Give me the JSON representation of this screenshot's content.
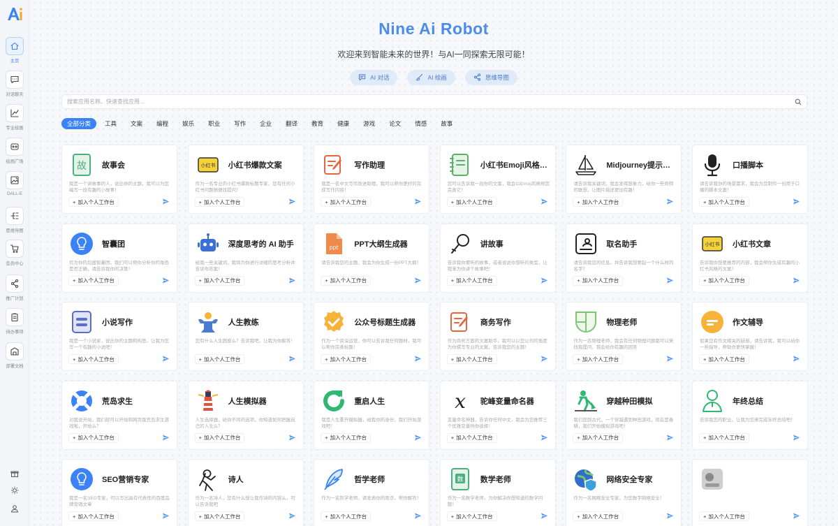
{
  "app": {
    "title": "Nine Ai Robot",
    "subtitle": "欢迎来到智能未来的世界！与AI一同探索无限可能！"
  },
  "sidebar": {
    "logo": {
      "text": "Ai",
      "colors": [
        "#3b82f6",
        "#f5a623"
      ]
    },
    "items": [
      {
        "label": "主页",
        "icon": "home-icon",
        "active": true
      },
      {
        "label": "对话聊天",
        "icon": "chat-icon"
      },
      {
        "label": "专业绘画",
        "icon": "chart-icon"
      },
      {
        "label": "绘画广场",
        "icon": "gallery-icon"
      },
      {
        "label": "DALL-E",
        "icon": "image-edit-icon"
      },
      {
        "label": "思维导图",
        "icon": "mindmap-icon"
      },
      {
        "label": "会员中心",
        "icon": "cart-icon"
      },
      {
        "label": "推广计划",
        "icon": "share-icon"
      },
      {
        "label": "待办事项",
        "icon": "clipboard-icon"
      },
      {
        "label": "部署文档",
        "icon": "building-icon"
      }
    ],
    "bottom": [
      {
        "icon": "gift-icon"
      },
      {
        "icon": "sun-icon"
      },
      {
        "icon": "user-icon"
      }
    ]
  },
  "quick_actions": [
    {
      "label": "AI 对话",
      "icon": "chat-icon"
    },
    {
      "label": "AI 绘画",
      "icon": "brush-icon"
    },
    {
      "label": "思维导图",
      "icon": "mindmap-icon"
    }
  ],
  "search": {
    "placeholder": "搜索应用名称、快速查找应用..."
  },
  "categories": [
    {
      "label": "全部分类",
      "active": true
    },
    {
      "label": "工具"
    },
    {
      "label": "文案"
    },
    {
      "label": "编程"
    },
    {
      "label": "娱乐"
    },
    {
      "label": "职业"
    },
    {
      "label": "写作"
    },
    {
      "label": "企业"
    },
    {
      "label": "翻译"
    },
    {
      "label": "教育"
    },
    {
      "label": "健康"
    },
    {
      "label": "游戏"
    },
    {
      "label": "论文"
    },
    {
      "label": "情感"
    },
    {
      "label": "故事"
    }
  ],
  "add_label": "加入个人工作台",
  "accent": "#3b82f6",
  "cards": [
    {
      "name": "故事会",
      "desc": "我是一个讲故事的人，说出你的主题，我可以为您编写一段有趣的小故事！",
      "icon": "book-icon",
      "color": "#4caf7d"
    },
    {
      "name": "小红书爆款文案",
      "desc": "作为一名专业的小红书爆款标题专家，您有任何小红书问题随便找提问！",
      "icon": "xiaohongshu-icon",
      "color": "#f5d23a"
    },
    {
      "name": "写作助理",
      "desc": "我是一名中文写作改进助理，我可以帮你更好的完成写作内容！",
      "icon": "edit-icon",
      "color": "#e8643c"
    },
    {
      "name": "小红书Emoji风格…",
      "desc": "您可以告诉我一段你的文案，我会以Emoji风格帮您完善它！",
      "icon": "notebook-icon",
      "color": "#5fae6a"
    },
    {
      "name": "Midjourney提示…",
      "desc": "请告诉我关键词，我会发挥想象力，给你一些奇特的联想，让图片描述更加有趣！",
      "icon": "sailboat-icon",
      "color": "#222222"
    },
    {
      "name": "口播脚本",
      "desc": "请告诉我你的场景需求，我会为您制作一份用于口播的脚本文案！",
      "icon": "microphone-icon",
      "color": "#222222"
    },
    {
      "name": "智囊团",
      "desc": "作为你的后援智囊团，我们可以帮你分析你的角色是否正确，请告诉我你的决策！",
      "icon": "bulb-icon",
      "color": "#3b82f6"
    },
    {
      "name": "深度思考的 AI 助手",
      "desc": "给我一些关键词，我将为你进行详细的思考分析并告诉你答案！",
      "icon": "robot-icon",
      "color": "#3b6fd6"
    },
    {
      "name": "PPT大纲生成器",
      "desc": "请告诉我您的主题，我会为你生成一份PPT大纲！",
      "icon": "ppt-icon",
      "color": "#f08a4b"
    },
    {
      "name": "讲故事",
      "desc": "告诉我你要听的故事，或者说说你想听的类型，让我来为你讲个故事吧！",
      "icon": "mic-icon",
      "color": "#222222"
    },
    {
      "name": "取名助手",
      "desc": "请告诉我您的信息，并告诉我想要起一个什么样的名字？",
      "icon": "name-card-icon",
      "color": "#222222"
    },
    {
      "name": "小红书文章",
      "desc": "告诉我你想要推荐的内容，我会帮你生成有趣的小红书风格的文案！",
      "icon": "xiaohongshu-icon",
      "color": "#f5d23a"
    },
    {
      "name": "小说写作",
      "desc": "我是一个小说家，说出你的主题和构思，让我为您写一个有趣的小说吧！",
      "icon": "notes-icon",
      "color": "#5b6cc9"
    },
    {
      "name": "人生教练",
      "desc": "您有什么人生困惑么？告诉我吧，让我为你解答！",
      "icon": "strongman-icon",
      "color": "#4a7bd0"
    },
    {
      "name": "公众号标题生成器",
      "desc": "作为一个资深运营，你可以告诉我任何题材，我可以帮你完善标题！",
      "icon": "badge-check-icon",
      "color": "#f5b33a"
    },
    {
      "name": "商务写作",
      "desc": "作为商务方面的文案助手，我可以以您公司的角度为你撰写专业的文案，告诉我您的主题！",
      "icon": "edit-icon",
      "color": "#e8643c"
    },
    {
      "name": "物理老师",
      "desc": "作为一名物理老师，我会有任何物理问题都可以来找我提问，我会给你有趣的回答",
      "icon": "physics-icon",
      "color": "#7cc576"
    },
    {
      "name": "作文辅导",
      "desc": "如果您有作文相关的疑惑，请告诉我，我可以给你一些指导，帮助你更快掌握！",
      "icon": "essay-icon",
      "color": "#f5b33a"
    },
    {
      "name": "荒岛求生",
      "desc": "对我说开始，我们就可以开始和网页版荒岛求生游戏啦，开始么？",
      "icon": "lifebuoy-icon",
      "color": "#3b82f6"
    },
    {
      "name": "人生模拟器",
      "desc": "人生选择器，给你不同的选项，你知道如何把握自己的人生么？",
      "icon": "lighthouse-icon",
      "color": "#e0533d"
    },
    {
      "name": "重启人生",
      "desc": "我是人生重开模拟器，给我你的身份，我们开始游戏吧！",
      "icon": "restart-icon",
      "color": "#2eb872"
    },
    {
      "name": "驼峰变量命名器",
      "desc": "变量命名神器，告诉你任何中文，我会为您推荐三个优雅变量供你选择！",
      "icon": "variable-icon",
      "color": "#222222"
    },
    {
      "name": "穿越种田模拟",
      "desc": "我们回到古代，一个穿越遇到种田游戏，现在是春耕，我们开始模拟游戏吧！",
      "icon": "farmer-icon",
      "color": "#2eb872"
    },
    {
      "name": "年终总结",
      "desc": "告诉我您的职业，让我为您来完成年终总结吧！",
      "icon": "person-icon",
      "color": "#2eb872"
    },
    {
      "name": "SEO营销专家",
      "desc": "我是一名SEO专家，可以写出具有代表性的百度品牌营销文章",
      "icon": "bulb-icon",
      "color": "#3b82f6"
    },
    {
      "name": "诗人",
      "desc": "作为一名诗人，您有什么想让我作诗的内容么，可以告诉我吧",
      "icon": "poet-icon",
      "color": "#222222"
    },
    {
      "name": "哲学老师",
      "desc": "作为一名哲学老师，请发表你的观点，帮你解答！",
      "icon": "feather-icon",
      "color": "#3b82f6"
    },
    {
      "name": "数学老师",
      "desc": "作为一名数学老师，为你解决你想知道的数学问题！",
      "icon": "math-book-icon",
      "color": "#4caf7d"
    },
    {
      "name": "网络安全专家",
      "desc": "作为一名网络安全专家，为您数字网络安全！",
      "icon": "shield-globe-icon",
      "color": "#3b82f6"
    },
    {
      "name": "",
      "desc": "",
      "icon": "blurred-avatar-icon",
      "color": "#888888"
    }
  ]
}
